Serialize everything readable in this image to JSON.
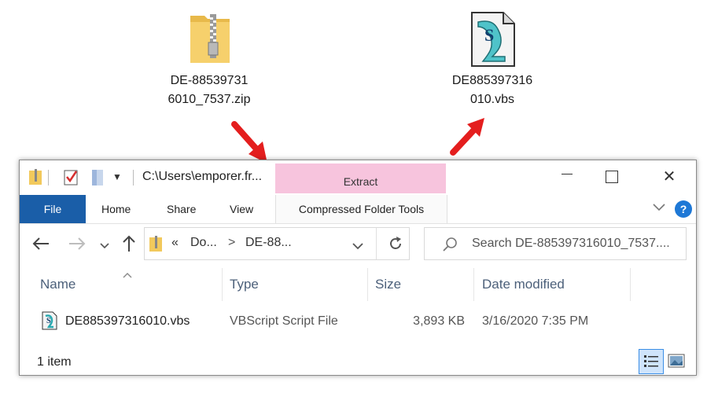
{
  "desktop": {
    "zip_icon": {
      "label_line1": "DE-88539731",
      "label_line2": "6010_7537.zip"
    },
    "vbs_icon": {
      "label_line1": "DE885397316",
      "label_line2": "010.vbs"
    }
  },
  "window": {
    "title_path": "C:\\Users\\emporer.fr...",
    "contextual_tab": "Extract",
    "controls": {
      "minimize": "—",
      "maximize": "☐",
      "close": "✕"
    }
  },
  "ribbon": {
    "tabs": [
      "File",
      "Home",
      "Share",
      "View",
      "Compressed Folder Tools"
    ],
    "help": "?"
  },
  "nav": {
    "breadcrumb_prefix": "«",
    "crumb1": "Do...",
    "crumb_sep": ">",
    "crumb2": "DE-88...",
    "search_placeholder": "Search DE-885397316010_7537...."
  },
  "table": {
    "columns": [
      "Name",
      "Type",
      "Size",
      "Date modified"
    ],
    "rows": [
      {
        "name": "DE885397316010.vbs",
        "type": "VBScript Script File",
        "size": "3,893 KB",
        "modified": "3/16/2020 7:35 PM"
      }
    ]
  },
  "status": {
    "count": "1 item"
  },
  "colors": {
    "file_tab": "#1a5ea8",
    "contextual": "#f7c4dd",
    "arrow": "#e41e1e",
    "header_text": "#4c607a"
  }
}
